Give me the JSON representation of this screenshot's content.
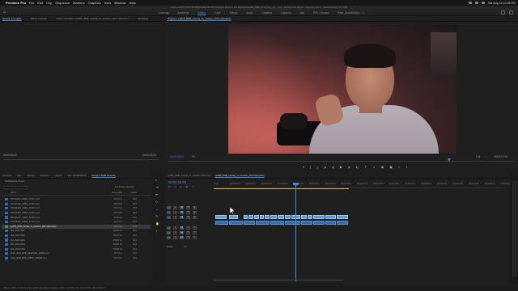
{
  "menubar": {
    "app_name": "Premiere Pro",
    "items": [
      "File",
      "Edit",
      "Clip",
      "Sequence",
      "Markers",
      "Graphics",
      "View",
      "Window",
      "Help"
    ],
    "datetime": "Sat Aug 10  10:44 PM"
  },
  "titlebar": {
    "text": "/Volumes/FAST SSD 2TB/PREMIERE PROJECTS/Adobe Premiere Pro Auto-Save/ep065_BNB_bo sis_tube_vs_.._mp4 - Premiere Pro Project - Original Lumen 2 - Adobe Premiere Pro 2019"
  },
  "workspaces": {
    "tabs": [
      "Learning",
      "Assembly",
      "Editing",
      "Color",
      "Effects",
      "Audio",
      "Graphics",
      "Libraries",
      "Ads",
      "PPS Concept",
      "Pixel_QuickEdit/jim"
    ],
    "active": "Editing",
    "more": "»"
  },
  "source": {
    "tabs": [
      "Source: (no clips)",
      "Effect Controls",
      "Audio Clip Mixer: ep065_BNB_tutorial_vs_session_PRO (Resolve)",
      "Metadata"
    ],
    "timecode_left": "00;00;00;00",
    "timecode_right": "00;00;00;00"
  },
  "program": {
    "title": "Program: ep065_BNB_tutorial_vs_session_PRO (Resolve)",
    "timecode_left": "00;02;22;03",
    "fit": "Fit",
    "quality": "Full",
    "timecode_right": "00;03;13;19"
  },
  "project": {
    "tabs": [
      "Libraries",
      "Info",
      "Effects",
      "Markers",
      "History",
      "Bin: 2020030373",
      "Project: 2020 Resolve"
    ],
    "active_tab": "Project: 2020 Resolve",
    "path": "2020Resolve Project",
    "item_count": "1 of 74 items selected",
    "columns": {
      "name": "Name",
      "frame_rate": "Frame Rate",
      "media_start": "Media"
    },
    "rows": [
      {
        "name": "DSC01231_1080p_SYNC.mp4",
        "frame_rate": "29.97 fps",
        "media": "00;0",
        "icon": "blue"
      },
      {
        "name": "DSC01232_1080p_SYNC.mp4",
        "frame_rate": "29.97 fps",
        "media": "00;0",
        "icon": "blue"
      },
      {
        "name": "DSC01233_1080p_SYNC.mp4",
        "frame_rate": "29.97 fps",
        "media": "00;0",
        "icon": "blue"
      },
      {
        "name": "DSC01234_1080p_SYNC.mp4",
        "frame_rate": "29.97 fps",
        "media": "00;0",
        "icon": "blue"
      },
      {
        "name": "DSC01235_1080p_SYNC.mp4",
        "frame_rate": "29.97 fps",
        "media": "00;0",
        "icon": "blue"
      },
      {
        "name": "DSC01236_1080p_SYNC.mp4",
        "frame_rate": "29.97 fps",
        "media": "00;0",
        "icon": "blue"
      },
      {
        "name": "ep065_BNB_tutorial_vs_session_PRO (Resolve)",
        "frame_rate": "29.97 fps",
        "media": "00;0",
        "icon": "green",
        "selected": true
      },
      {
        "name": "002_0001.WAV",
        "frame_rate": "48000 Hz",
        "media": "00;0",
        "icon": "blue"
      },
      {
        "name": "002_0002.WAV",
        "frame_rate": "48000 Hz",
        "media": "00;0",
        "icon": "blue"
      },
      {
        "name": "002_0003.WAV",
        "frame_rate": "48000 Hz",
        "media": "00;0",
        "icon": "blue"
      },
      {
        "name": "002_0004.WAV",
        "frame_rate": "48000 Hz",
        "media": "00;0",
        "icon": "blue"
      },
      {
        "name": "002_0005.WAV",
        "frame_rate": "48000 Hz",
        "media": "00;0",
        "icon": "blue"
      },
      {
        "name": "Draft_0019_BNB_RESOLVE_1080P.mov",
        "frame_rate": "29.97 fps",
        "media": "00;0",
        "icon": "blue"
      },
      {
        "name": "Draft_0020_BNB_1080P_GRADE.mov",
        "frame_rate": "29.97 fps",
        "media": "00;0",
        "icon": "blue"
      }
    ]
  },
  "timeline": {
    "tabs": [
      "ep065_BNB_tutorial_vs_session_PRO (R)",
      "ep065_BNB_tutorial_vs_session_PRO (Resolve)"
    ],
    "active_tab": "ep065_BNB_tutorial_vs_session_PRO (Resolve)",
    "timecode": "00;02;22;03",
    "ruler_labels": [
      "00;00",
      "00;00;16;00",
      "00;00;32;00",
      "00;00;48;00",
      "00;01;04;02",
      "00;01;20;02",
      "00;01;36;02",
      "00;01;52;02",
      "00;02;08;04",
      "00;02;24;04",
      "00;02;40;04",
      "00;02;56;04",
      "00;03;12;04",
      "00;03;28;06",
      "00;03;44;06",
      "00;04;00;06",
      "00;04;16;08",
      "00;04;32;08",
      "00;04;48;08"
    ],
    "tracks": [
      {
        "name": "V3"
      },
      {
        "name": "V2"
      },
      {
        "name": "V1"
      },
      {
        "name": "A1"
      },
      {
        "name": "A2"
      },
      {
        "name": "A3"
      }
    ],
    "master": {
      "label": "Master",
      "value": "0.0"
    }
  },
  "status": {
    "text": "Click to select, or click in empty space and drag to marquee select. Use Shift, Opt, and Cmd for other options."
  }
}
